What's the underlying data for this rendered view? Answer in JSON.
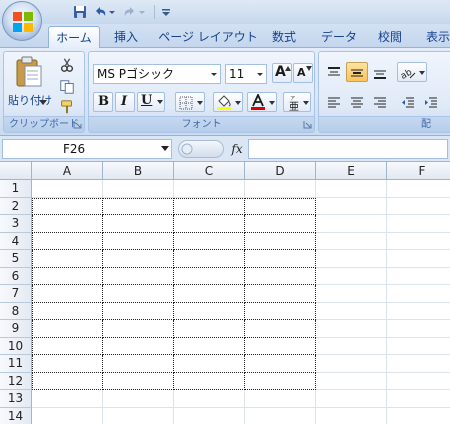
{
  "tabs": [
    "ホーム",
    "挿入",
    "ページ レイアウト",
    "数式",
    "データ",
    "校閲",
    "表示"
  ],
  "active_tab": 0,
  "ribbon": {
    "clipboard": {
      "paste_label": "貼り付け",
      "group_label": "クリップボード"
    },
    "font": {
      "font_name": "MS Pゴシック",
      "font_size": "11",
      "bold": "B",
      "italic": "I",
      "underline": "U",
      "grow": "A",
      "shrink": "A",
      "group_label": "フォント"
    },
    "alignment": {
      "group_label": "配"
    }
  },
  "formula_bar": {
    "name_box": "F26",
    "fx": "fx",
    "formula": ""
  },
  "sheet": {
    "columns": [
      "A",
      "B",
      "C",
      "D",
      "E",
      "F"
    ],
    "rows": [
      "1",
      "2",
      "3",
      "4",
      "5",
      "6",
      "7",
      "8",
      "9",
      "10",
      "11",
      "12",
      "13",
      "14"
    ]
  },
  "colors": {
    "ribbon_blue": "#15428b",
    "font_color_bar": "#e00000",
    "highlight_bar": "#ffff00"
  }
}
